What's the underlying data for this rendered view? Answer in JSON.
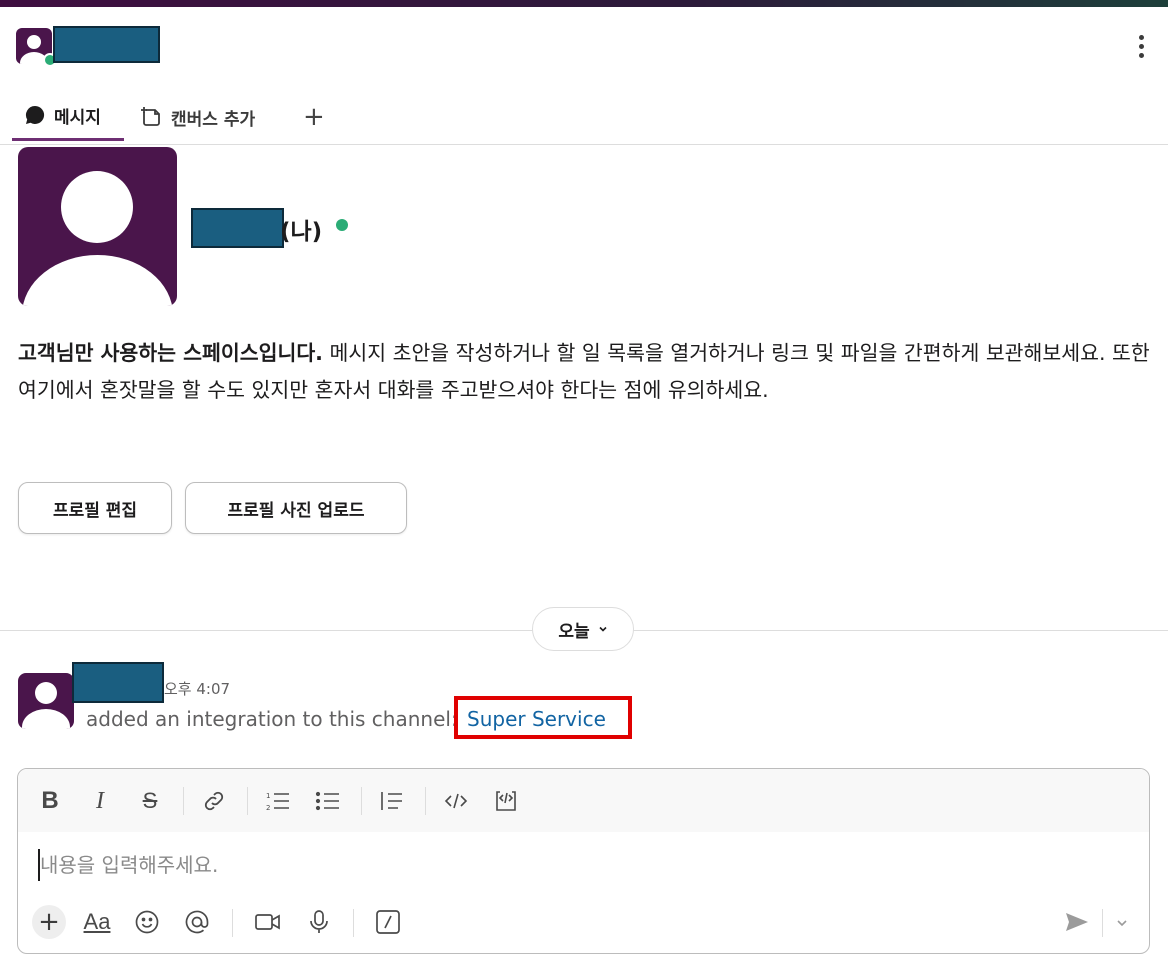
{
  "header": {
    "tabs": [
      {
        "label": "메시지"
      },
      {
        "label": "캔버스 추가"
      }
    ],
    "add_tab_label": "+"
  },
  "intro": {
    "me_suffix": "(나)",
    "bold_text": "고객님만 사용하는 스페이스입니다.",
    "body_text": " 메시지 초안을 작성하거나 할 일 목록을 열거하거나 링크 및 파일을 간편하게 보관해보세요. 또한 여기에서 혼잣말을 할 수도 있지만 혼자서 대화를 주고받으셔야 한다는 점에 유의하세요.",
    "edit_profile_label": "프로필 편집",
    "upload_photo_label": "프로필 사진 업로드"
  },
  "divider": {
    "day_label": "오늘"
  },
  "message": {
    "time": "오후 4:07",
    "text": "added an integration to this channel:",
    "link": "Super Service"
  },
  "composer": {
    "placeholder": "내용을 입력해주세요.",
    "format_icons": [
      "bold-icon",
      "italic-icon",
      "strikethrough-icon",
      "link-icon",
      "ordered-list-icon",
      "bullet-list-icon",
      "blockquote-icon",
      "code-icon",
      "code-block-icon"
    ],
    "action_icons": [
      "plus-icon",
      "format-text-icon",
      "emoji-icon",
      "mention-icon",
      "video-icon",
      "microphone-icon",
      "slash-command-icon",
      "send-icon",
      "send-options-icon"
    ]
  },
  "colors": {
    "brand": "#4a154b",
    "presence": "#2bac76",
    "link": "#1264a3",
    "highlight": "#e00000",
    "redaction": "#1a5e80"
  }
}
